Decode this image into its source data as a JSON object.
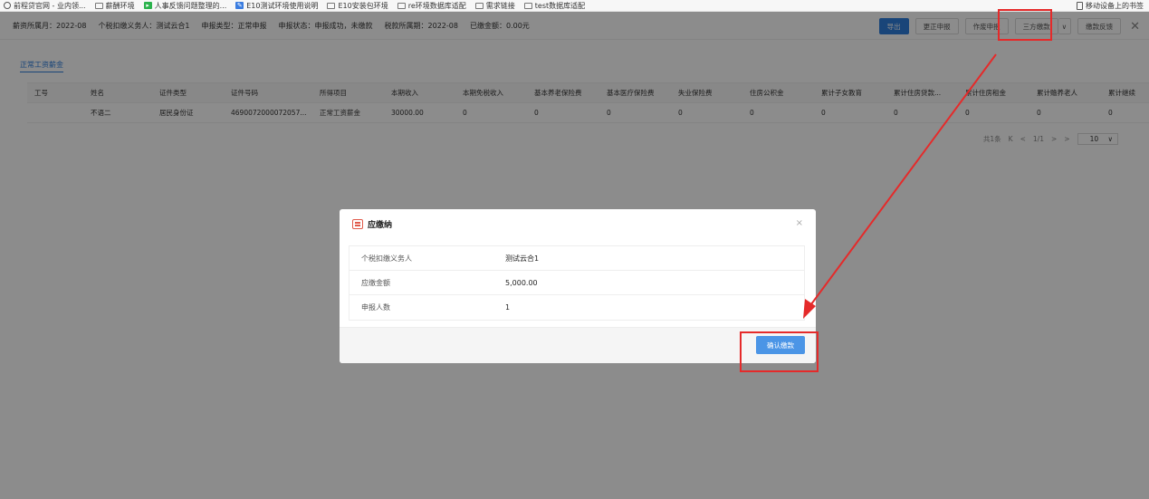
{
  "bookmarks": {
    "items": [
      {
        "label": "前程贷官网 - 业内领...",
        "icon": "globe-icon"
      },
      {
        "label": "薪酬环境",
        "icon": "folder-icon"
      },
      {
        "label": "人事反馈问题整理的...",
        "icon": "play-icon"
      },
      {
        "label": "E10测试环境使用说明",
        "icon": "edit-icon"
      },
      {
        "label": "E10安装包环境",
        "icon": "folder-icon"
      },
      {
        "label": "re环境数据库适配",
        "icon": "folder-icon"
      },
      {
        "label": "需求链接",
        "icon": "folder-icon"
      },
      {
        "label": "test数据库适配",
        "icon": "folder-icon"
      }
    ],
    "mobile": "移动设备上的书签"
  },
  "infobar": {
    "items": [
      "薪资所属月：2022-08",
      "个税扣缴义务人：测试云合1",
      "申报类型：正常申报",
      "申报状态：申报成功，未缴款",
      "税款所属期：2022-08",
      "已缴金额：0.00元"
    ]
  },
  "toolbar": {
    "export": "导出",
    "correct": "更正申报",
    "void": "作废申报",
    "third_party": "三方缴款",
    "feedback": "缴款反馈",
    "dropdown": "∨",
    "close": "✕"
  },
  "tabs": {
    "active": "正常工资薪金"
  },
  "table": {
    "headers": [
      "工号",
      "姓名",
      "证件类型",
      "证件号码",
      "所得项目",
      "本期收入",
      "本期免税收入",
      "基本养老保险费",
      "基本医疗保险费",
      "失业保险费",
      "住房公积金",
      "累计子女教育",
      "累计住房贷款...",
      "累计住房租金",
      "累计赡养老人",
      "累计继续"
    ],
    "rows": [
      [
        "",
        "不语二",
        "居民身份证",
        "4690072000072057...",
        "正常工资薪金",
        "30000.00",
        "0",
        "0",
        "0",
        "0",
        "0",
        "0",
        "0",
        "0",
        "0",
        "0"
      ]
    ]
  },
  "pager": {
    "total": "共1条",
    "first": "K",
    "prev": "<",
    "page": "1/1",
    "next": ">",
    "last": ">",
    "size": "10",
    "size_arrow": "∨"
  },
  "modal": {
    "title": "应缴纳",
    "close": "×",
    "rows": [
      {
        "label": "个税扣缴义务人",
        "value": "测试云合1"
      },
      {
        "label": "应缴金额",
        "value": "5,000.00"
      },
      {
        "label": "申报人数",
        "value": "1"
      }
    ],
    "confirm": "确认缴款"
  },
  "colors": {
    "primary": "#2f7fdc",
    "annotation": "#e52a2a"
  }
}
